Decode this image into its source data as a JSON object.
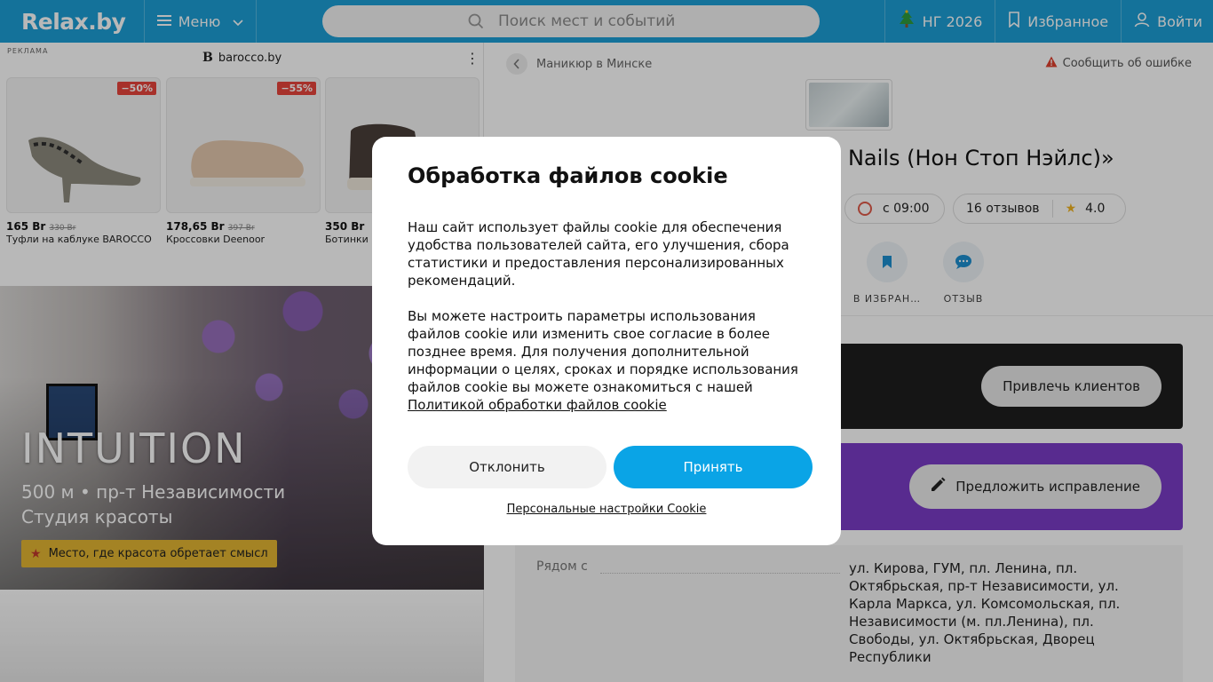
{
  "header": {
    "logo": "Relax.by",
    "menu_label": "Меню",
    "search_placeholder": "Поиск мест и событий",
    "ng_label": "НГ 2026",
    "favorites_label": "Избранное",
    "login_label": "Войти"
  },
  "ad": {
    "label": "РЕКЛАМА",
    "brand": "barocco.by",
    "products": [
      {
        "discount": "−50%",
        "price": "165 Br",
        "old_price": "330 Br",
        "name": "Туфли на каблуке BAROCCO"
      },
      {
        "discount": "−55%",
        "price": "178,65 Br",
        "old_price": "397 Br",
        "name": "Кроссовки Deenoor"
      },
      {
        "discount": "",
        "price": "350 Br",
        "old_price": "",
        "name": "Ботинки S"
      }
    ]
  },
  "hero": {
    "title": "INTUITION",
    "subtitle_line1": "500 м • пр-т Независимости",
    "subtitle_line2": "Студия красоты",
    "badge": "Место, где красота обретает смысл"
  },
  "place": {
    "breadcrumb": "Маникюр в Минске",
    "report": "Сообщить об ошибке",
    "title": "top Nails (Нон Стоп Нэйлс)»",
    "open_time": "с 09:00",
    "reviews": "16 отзывов",
    "rating": "4.0",
    "action_favorite": "В ИЗБРАН…",
    "action_review": "ОТЗЫВ",
    "attract_button": "Привлечь клиентов",
    "suggest_button": "Предложить исправление",
    "near_label": "Рядом с",
    "near_value": "ул. Кирова, ГУМ, пл. Ленина, пл. Октябрьская, пр-т Независимости, ул. Карла Маркса, ул. Комсомольская, пл. Независимости (м. пл.Ленина), пл. Свободы, ул. Октябрьская, Дворец Республики"
  },
  "cookie": {
    "title": "Обработка файлов cookie",
    "text1": "Наш сайт использует файлы cookie для обеспечения удобства пользователей сайта, его улучшения, сбора статистики и предоставления персонализированных рекомендаций.",
    "text2": "Вы можете настроить параметры использования файлов cookie или изменить свое согласие в более позднее время. Для получения дополнительной информации о целях, сроках и порядке использования файлов cookie вы можете ознакомиться с нашей",
    "policy_link": "Политикой обработки файлов cookie",
    "decline": "Отклонить",
    "accept": "Принять",
    "settings": "Персональные настройки Cookie"
  },
  "colors": {
    "header": "#1d9fd6",
    "accept": "#0aa4e6",
    "purple_band": "#7b3cc6",
    "badge": "#e3b632"
  }
}
